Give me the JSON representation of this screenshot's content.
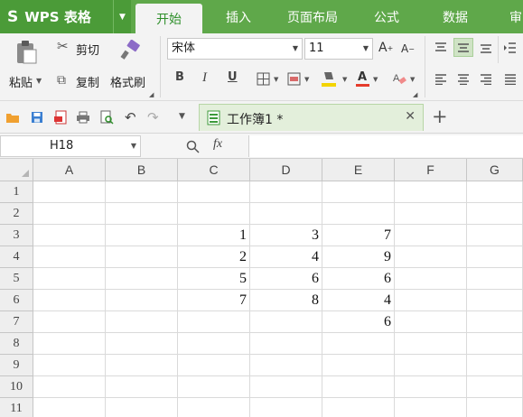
{
  "app": {
    "logo": "S",
    "name": "WPS 表格"
  },
  "tabs": [
    {
      "label": "开始",
      "active": true
    },
    {
      "label": "插入",
      "active": false
    },
    {
      "label": "页面布局",
      "active": false
    },
    {
      "label": "公式",
      "active": false
    },
    {
      "label": "数据",
      "active": false
    },
    {
      "label": "审",
      "active": false
    }
  ],
  "ribbon": {
    "paste": "粘贴",
    "cut": "剪切",
    "copy": "复制",
    "format_painter": "格式刷",
    "font_name": "宋体",
    "font_size": "11",
    "bold": "B",
    "italic": "I",
    "underline": "U",
    "font_color_letter": "A",
    "fx_label": "fx"
  },
  "document": {
    "tab_name": "工作簿1 *"
  },
  "namebox": {
    "value": "H18"
  },
  "formula": {
    "value": ""
  },
  "sheet": {
    "columns": [
      "A",
      "B",
      "C",
      "D",
      "E",
      "F",
      "G"
    ],
    "rows": [
      {
        "num": "1",
        "cells": [
          "",
          "",
          "",
          "",
          "",
          "",
          ""
        ]
      },
      {
        "num": "2",
        "cells": [
          "",
          "",
          "",
          "",
          "",
          "",
          ""
        ]
      },
      {
        "num": "3",
        "cells": [
          "",
          "",
          "1",
          "3",
          "7",
          "",
          ""
        ]
      },
      {
        "num": "4",
        "cells": [
          "",
          "",
          "2",
          "4",
          "9",
          "",
          ""
        ]
      },
      {
        "num": "5",
        "cells": [
          "",
          "",
          "5",
          "6",
          "6",
          "",
          ""
        ]
      },
      {
        "num": "6",
        "cells": [
          "",
          "",
          "7",
          "8",
          "4",
          "",
          ""
        ]
      },
      {
        "num": "7",
        "cells": [
          "",
          "",
          "",
          "",
          "6",
          "",
          ""
        ]
      },
      {
        "num": "8",
        "cells": [
          "",
          "",
          "",
          "",
          "",
          "",
          ""
        ]
      },
      {
        "num": "9",
        "cells": [
          "",
          "",
          "",
          "",
          "",
          "",
          ""
        ]
      },
      {
        "num": "10",
        "cells": [
          "",
          "",
          "",
          "",
          "",
          "",
          ""
        ]
      },
      {
        "num": "11",
        "cells": [
          "",
          "",
          "",
          "",
          "",
          "",
          ""
        ]
      }
    ]
  },
  "colors": {
    "brand_green": "#5fa84a",
    "active_tab_text": "#2e8f2a"
  }
}
